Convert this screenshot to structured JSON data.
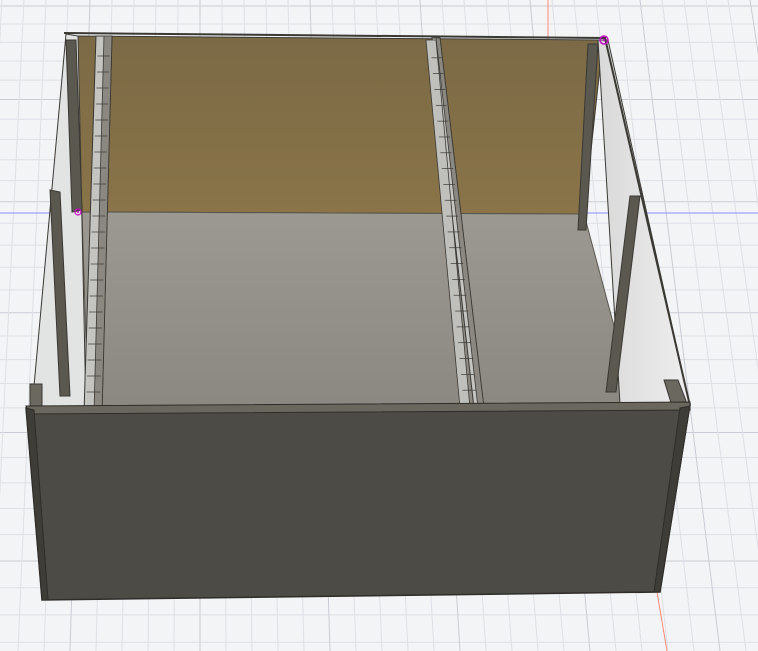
{
  "viewport": {
    "background": "#f3f4f6",
    "grid": "on",
    "grid_minor_color": "#dde0e5",
    "grid_major_color": "#c9cdd3",
    "axis_x_color": "#7f7fff",
    "axis_y_color": "#ff8a7a"
  },
  "model": {
    "name_icon": "open-box-with-two-divider-icon",
    "colors": {
      "back_wall": "#7e6a45",
      "floor": "#8f8d86",
      "front_wall": "#4c4a44",
      "side_wall_light": "#e7e8e8",
      "edge": "#3a3833",
      "cleat_dark": "#57544d",
      "vertex_marker": "#cc00cc"
    },
    "compartments": 3,
    "divider_slot_rows": 14
  }
}
